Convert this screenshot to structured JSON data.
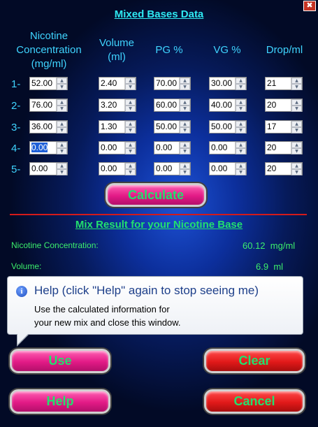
{
  "window": {
    "title": "Mixed Bases Data",
    "close_glyph": "✖"
  },
  "headers": [
    "Nicotine Concentration (mg/ml)",
    "Volume (ml)",
    "PG %",
    "VG %",
    "Drop/ml"
  ],
  "header_lines": [
    [
      "Nicotine",
      "Concentration",
      "(mg/ml)"
    ],
    [
      "Volume",
      "(ml)"
    ],
    [
      "PG %"
    ],
    [
      "VG %"
    ],
    [
      "Drop/ml"
    ]
  ],
  "rows": [
    {
      "label": "1-",
      "nicotine": "52.00",
      "volume": "2.40",
      "pg": "70.00",
      "vg": "30.00",
      "drop": "21"
    },
    {
      "label": "2-",
      "nicotine": "76.00",
      "volume": "3.20",
      "pg": "60.00",
      "vg": "40.00",
      "drop": "20"
    },
    {
      "label": "3-",
      "nicotine": "36.00",
      "volume": "1.30",
      "pg": "50.00",
      "vg": "50.00",
      "drop": "17"
    },
    {
      "label": "4-",
      "nicotine": "0.00",
      "volume": "0.00",
      "pg": "0.00",
      "vg": "0.00",
      "drop": "20"
    },
    {
      "label": "5-",
      "nicotine": "0.00",
      "volume": "0.00",
      "pg": "0.00",
      "vg": "0.00",
      "drop": "20"
    }
  ],
  "buttons": {
    "calculate": "Calculate",
    "use": "Use",
    "clear": "Clear",
    "help": "Help",
    "cancel": "Cancel"
  },
  "result": {
    "title": "Mix Result for your Nicotine Base",
    "nicotine_label": "Nicotine Concentration:",
    "nicotine_value": "60.12",
    "nicotine_unit": "mg/ml",
    "volume_label": "Volume:",
    "volume_value": "6.9",
    "volume_unit": "ml"
  },
  "tooltip": {
    "title": "Help (click \"Help\" again to stop seeing me)",
    "body_line1": "Use the calculated information for",
    "body_line2": "your new mix and close this window."
  },
  "colors": {
    "title": "#2ee9f2",
    "header": "#3fd4ff",
    "result": "#3cee6c",
    "separator": "#d41a1a",
    "button_text": "#22e06e"
  }
}
